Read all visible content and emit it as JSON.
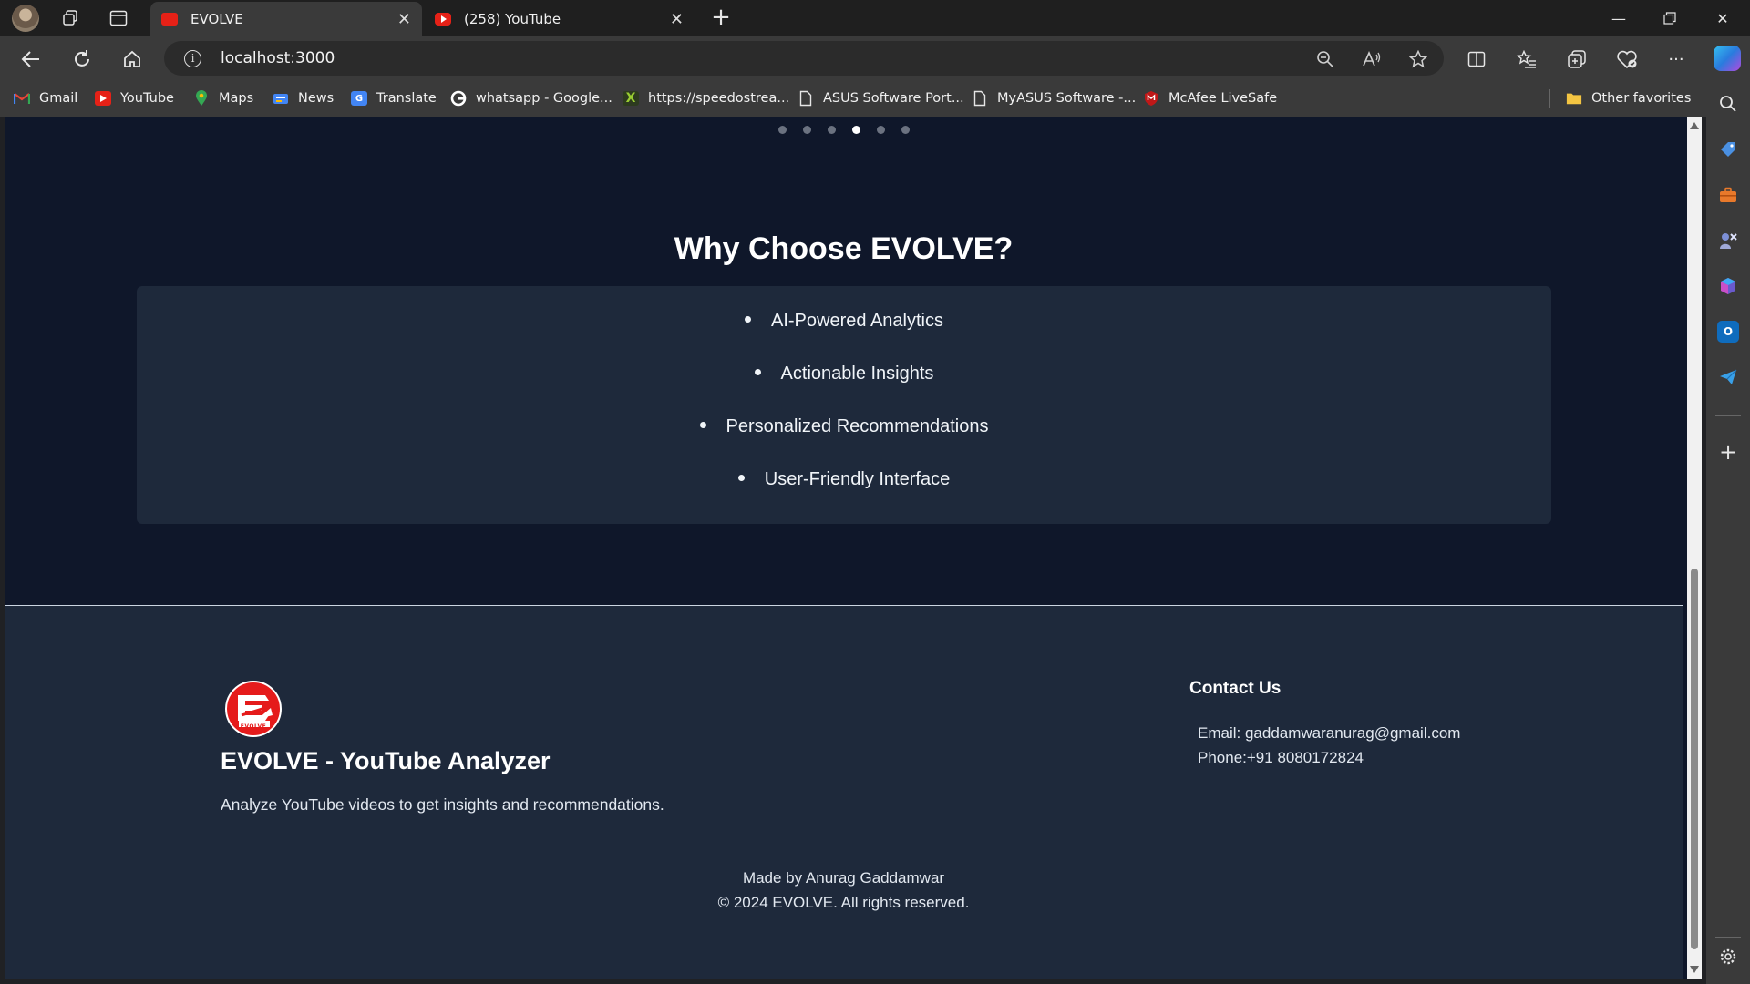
{
  "browser": {
    "tabs": [
      {
        "title": "EVOLVE",
        "active": true
      },
      {
        "title": "(258) YouTube",
        "active": false
      }
    ],
    "address": "localhost:3000",
    "bookmarks": [
      {
        "label": "Gmail",
        "icon": "gmail-icon"
      },
      {
        "label": "YouTube",
        "icon": "youtube-icon"
      },
      {
        "label": "Maps",
        "icon": "maps-icon"
      },
      {
        "label": "News",
        "icon": "news-icon"
      },
      {
        "label": "Translate",
        "icon": "translate-icon"
      },
      {
        "label": "whatsapp - Google...",
        "icon": "google-icon"
      },
      {
        "label": "https://speedostrea...",
        "icon": "x-icon"
      },
      {
        "label": "ASUS Software Port...",
        "icon": "page-icon"
      },
      {
        "label": "MyASUS Software -...",
        "icon": "page-icon"
      },
      {
        "label": "McAfee LiveSafe",
        "icon": "mcafee-icon"
      }
    ],
    "other_favorites": "Other favorites"
  },
  "carousel": {
    "dot_count": 6,
    "active_index": 3
  },
  "why": {
    "title": "Why Choose EVOLVE?",
    "items": [
      "AI-Powered Analytics",
      "Actionable Insights",
      "Personalized Recommendations",
      "User-Friendly Interface"
    ]
  },
  "footer": {
    "logo_text": "EVOLVE",
    "brand": "EVOLVE - YouTube Analyzer",
    "tagline": "Analyze YouTube videos to get insights and recommendations.",
    "contact_heading": "Contact Us",
    "email": "Email: gaddamwaranurag@gmail.com",
    "phone": "Phone:+91 8080172824",
    "made_by": "Made by Anurag Gaddamwar",
    "copyright": "© 2024 EVOLVE. All rights reserved."
  },
  "colors": {
    "page_bg": "#0f172a",
    "card_bg": "#1e293b",
    "brand_red": "#e51b1b",
    "browser_chrome": "#3a3a3a"
  }
}
